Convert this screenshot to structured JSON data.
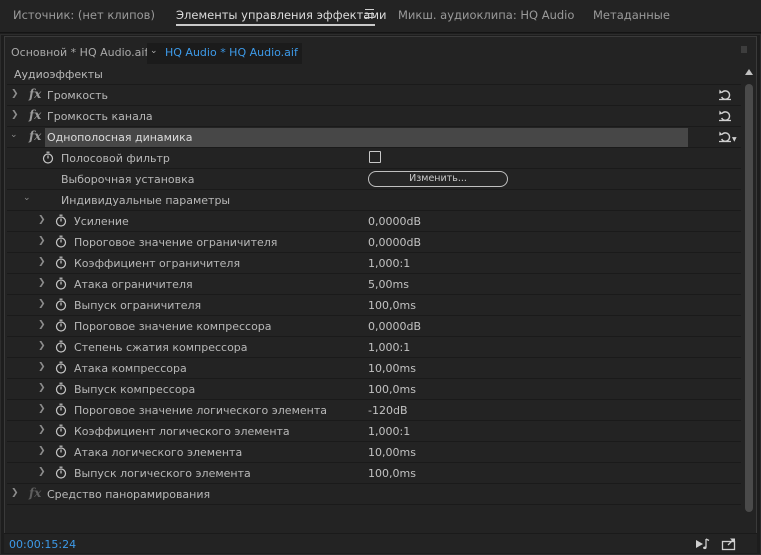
{
  "tabs": [
    {
      "label": "Источник: (нет клипов)"
    },
    {
      "label": "Элементы управления эффектами"
    },
    {
      "label": "Микш. аудиоклипа: HQ Audio"
    },
    {
      "label": "Метаданные"
    }
  ],
  "clip_bar": {
    "master_clip": "Основной * HQ Audio.aif",
    "current_clip": "HQ Audio * HQ Audio.aif"
  },
  "section_header": "Аудиоэффекты",
  "effects": [
    {
      "label": "Громкость"
    },
    {
      "label": "Громкость канала"
    },
    {
      "label": "Однополосная динамика"
    }
  ],
  "band_filter": {
    "label": "Полосовой фильтр",
    "checked": false
  },
  "custom_setup": {
    "label": "Выборочная установка",
    "button": "Изменить..."
  },
  "individual_params": {
    "label": "Индивидуальные параметры",
    "items": [
      {
        "label": "Усиление",
        "value": "0,0000dB"
      },
      {
        "label": "Пороговое значение ограничителя",
        "value": "0,0000dB"
      },
      {
        "label": "Коэффициент ограничителя",
        "value": "1,000:1"
      },
      {
        "label": "Атака ограничителя",
        "value": "5,00ms"
      },
      {
        "label": "Выпуск ограничителя",
        "value": "100,0ms"
      },
      {
        "label": "Пороговое значение компрессора",
        "value": "0,0000dB"
      },
      {
        "label": "Степень сжатия компрессора",
        "value": "1,000:1"
      },
      {
        "label": "Атака компрессора",
        "value": "10,00ms"
      },
      {
        "label": "Выпуск компрессора",
        "value": "100,0ms"
      },
      {
        "label": "Пороговое значение логического элемента",
        "value": "-120dB"
      },
      {
        "label": "Коэффициент логического элемента",
        "value": "1,000:1"
      },
      {
        "label": "Атака логического элемента",
        "value": "10,00ms"
      },
      {
        "label": "Выпуск логического элемента",
        "value": "100,0ms"
      }
    ]
  },
  "panner": {
    "label": "Средство панорамирования"
  },
  "status": {
    "timecode": "00:00:15:24"
  },
  "colors": {
    "accent_blue": "#3d9ae8",
    "panel_bg": "#232323",
    "selected_bg": "#474747"
  },
  "icons": [
    "menu-icon",
    "chevron-down-icon",
    "chevron-right-icon",
    "fx-icon",
    "stopwatch-icon",
    "reset-icon",
    "checkbox-icon",
    "scroll-up-icon",
    "play-audio-icon",
    "export-icon",
    "grip-icon"
  ]
}
